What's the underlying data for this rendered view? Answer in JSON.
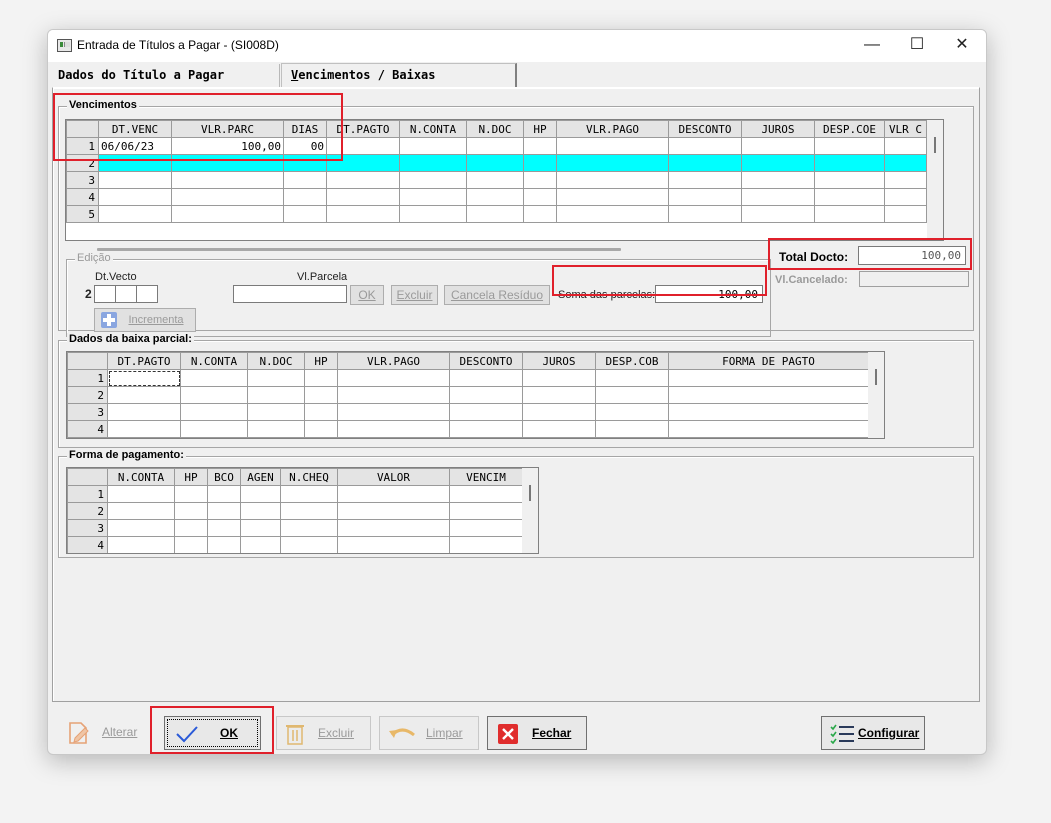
{
  "window": {
    "title": "Entrada de Títulos a Pagar - (SI008D)",
    "minimize_glyph": "—",
    "maximize_glyph": "☐",
    "close_glyph": "✕"
  },
  "tabs": [
    {
      "label": "Dados do Título a Pagar"
    },
    {
      "label": "Vencimentos / Baixas",
      "active": true
    }
  ],
  "vencimentos": {
    "label": "Vencimentos",
    "columns": [
      "DT.VENC",
      "VLR.PARC",
      "DIAS",
      "DT.PAGTO",
      "N.CONTA",
      "N.DOC",
      "HP",
      "VLR.PAGO",
      "DESCONTO",
      "JUROS",
      "DESP.COE",
      "VLR C"
    ],
    "rows": [
      {
        "n": "1",
        "cells": [
          "06/06/23",
          "100,00",
          "00",
          "",
          "",
          "",
          "",
          "",
          "",
          "",
          "",
          ""
        ]
      },
      {
        "n": "2",
        "cells": [
          "",
          "",
          "",
          "",
          "",
          "",
          "",
          "",
          "",
          "",
          "",
          ""
        ]
      },
      {
        "n": "3",
        "cells": [
          "",
          "",
          "",
          "",
          "",
          "",
          "",
          "",
          "",
          "",
          "",
          ""
        ]
      },
      {
        "n": "4",
        "cells": [
          "",
          "",
          "",
          "",
          "",
          "",
          "",
          "",
          "",
          "",
          "",
          ""
        ]
      },
      {
        "n": "5",
        "cells": [
          "",
          "",
          "",
          "",
          "",
          "",
          "",
          "",
          "",
          "",
          "",
          ""
        ]
      }
    ]
  },
  "edicao": {
    "label": "Edição",
    "dt_vecto_label": "Dt.Vecto",
    "row_number": "2",
    "vl_parcela_label": "Vl.Parcela",
    "ok_label": "OK",
    "excluir_label": "Excluir",
    "cancela_residuo_label": "Cancela Resíduo",
    "soma_label": "Soma das parcelas:",
    "soma_value": "100,00",
    "incrementa_label": "Incrementa"
  },
  "totals": {
    "total_docto_label": "Total Docto:",
    "total_docto_value": "100,00",
    "vl_cancelado_label": "Vl.Cancelado:",
    "vl_cancelado_value": ""
  },
  "baixa_parcial": {
    "label": "Dados da baixa parcial:",
    "columns": [
      "DT.PAGTO",
      "N.CONTA",
      "N.DOC",
      "HP",
      "VLR.PAGO",
      "DESCONTO",
      "JUROS",
      "DESP.COB",
      "FORMA DE PAGTO"
    ],
    "rows": [
      "1",
      "2",
      "3",
      "4"
    ]
  },
  "forma_pagamento": {
    "label": "Forma de pagamento:",
    "columns": [
      "N.CONTA",
      "HP",
      "BCO",
      "AGEN",
      "N.CHEQ",
      "VALOR",
      "VENCIM"
    ],
    "rows": [
      "1",
      "2",
      "3",
      "4"
    ]
  },
  "buttons": {
    "alterar": "Alterar",
    "ok": "OK",
    "excluir": "Excluir",
    "limpar": "Limpar",
    "fechar": "Fechar",
    "configurar": "Configurar"
  },
  "colors": {
    "highlight_row": "#00ffff",
    "highlight_rownum": "#e08080",
    "annotation_red": "#e0202b",
    "fechar_red": "#e02d2d",
    "check_blue": "#2a5ad8"
  }
}
